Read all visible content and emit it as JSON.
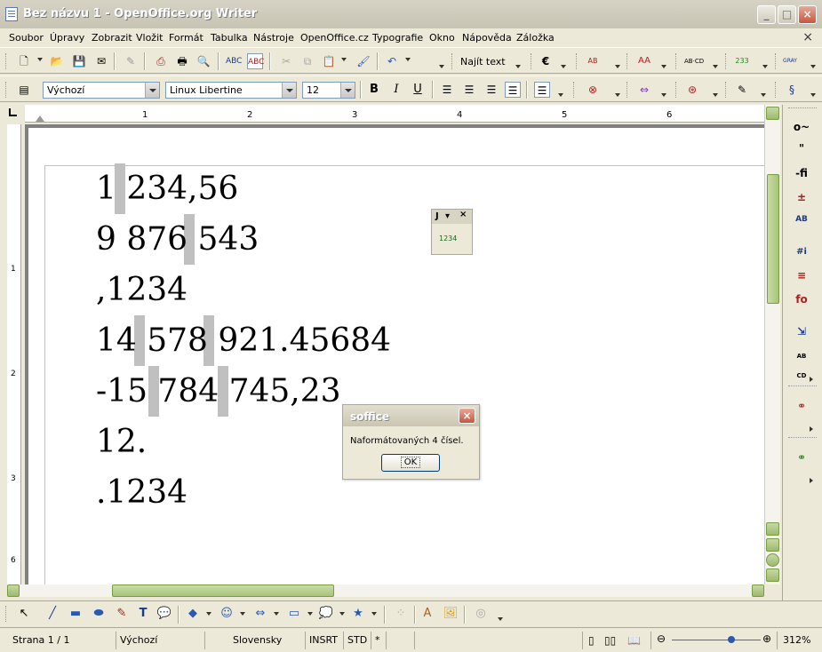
{
  "window": {
    "title": "Bez názvu 1 - OpenOffice.org Writer",
    "min_glyph": "_",
    "max_glyph": "□",
    "close_glyph": "×"
  },
  "menu": {
    "items": [
      "Soubor",
      "Úpravy",
      "Zobrazit",
      "Vložit",
      "Formát",
      "Tabulka",
      "Nástroje",
      "OpenOffice.cz",
      "Typografie",
      "Okno",
      "Nápověda",
      "Záložka"
    ],
    "close_glyph": "×"
  },
  "standard_toolbar": {
    "find_text": "Najít text"
  },
  "format_toolbar": {
    "style": "Výchozí",
    "font": "Linux Libertine",
    "size": "12"
  },
  "ruler": {
    "h_numbers": [
      "1",
      "2",
      "3",
      "4",
      "5",
      "6"
    ],
    "v_numbers": [
      "1",
      "2",
      "3",
      "6"
    ]
  },
  "document": {
    "lines": [
      "1 234,56",
      "9 876 543",
      ",1234",
      "14 578 921.45684",
      "-15 784 745,23",
      "12.",
      ".1234"
    ]
  },
  "mini_toolbar": {
    "title": "J",
    "label": "1234"
  },
  "dialog": {
    "title": "soffice",
    "message": "Naformátovaných 4 čísel.",
    "ok": "OK",
    "close_glyph": "×"
  },
  "status": {
    "page": "Strana 1 / 1",
    "style": "Výchozí",
    "language": "Slovensky",
    "insert_mode": "INSRT",
    "selection_mode": "STD",
    "modified": "*",
    "zoom": "312%"
  },
  "sidebar": {
    "icons": [
      "o~",
      "\"",
      "-fi",
      "±",
      "AB",
      "#i",
      "≡",
      "fo",
      "⇲",
      "AB CD",
      "binoculars-red",
      "binoculars-green"
    ]
  },
  "accent": {
    "scrollbar": "#a8c478",
    "close": "#c8563e"
  }
}
